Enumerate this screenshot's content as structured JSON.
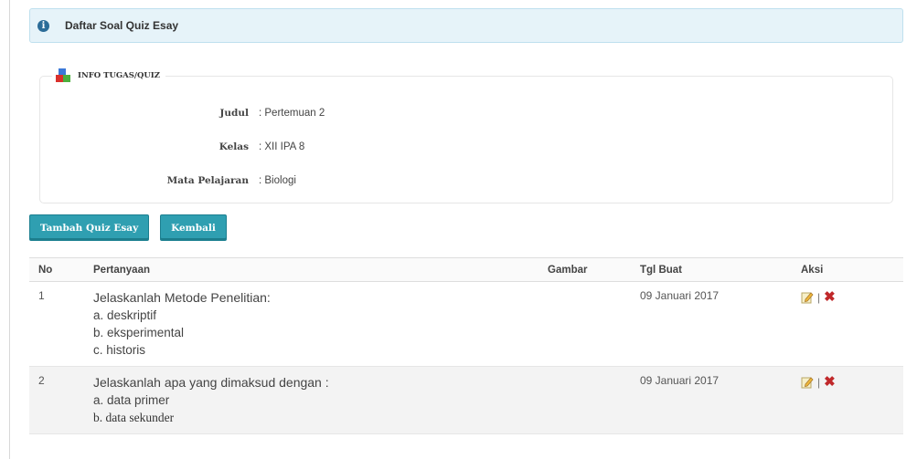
{
  "alert": {
    "title": "Daftar Soal Quiz Esay",
    "icon": "info-icon"
  },
  "info": {
    "legend": "INFO TUGAS/QUIZ",
    "icon": "stack-icon",
    "fields": [
      {
        "label": "Judul",
        "value": ": Pertemuan 2"
      },
      {
        "label": "Kelas",
        "value": ": XII IPA 8"
      },
      {
        "label": "Mata Pelajaran",
        "value": ": Biologi"
      }
    ]
  },
  "buttons": {
    "add": "Tambah Quiz Esay",
    "back": "Kembali"
  },
  "table": {
    "headers": {
      "no": "No",
      "question": "Pertanyaan",
      "image": "Gambar",
      "date": "Tgl Buat",
      "action": "Aksi"
    },
    "rows": [
      {
        "no": "1",
        "question": "Jelaskanlah Metode Penelitian:",
        "options": [
          "a. deskriptif",
          "b. eksperimental",
          "c. historis"
        ],
        "image": "",
        "date": "09 Januari 2017",
        "separator": "|"
      },
      {
        "no": "2",
        "question": "Jelaskanlah apa yang dimaksud dengan :",
        "options": [
          "a. data primer",
          "b. data sekunder"
        ],
        "image": "",
        "date": "09 Januari 2017",
        "separator": "|"
      }
    ]
  },
  "colors": {
    "button": "#2f9fb1",
    "alert_bg": "#e6f3f9",
    "delete": "#c0282a"
  }
}
